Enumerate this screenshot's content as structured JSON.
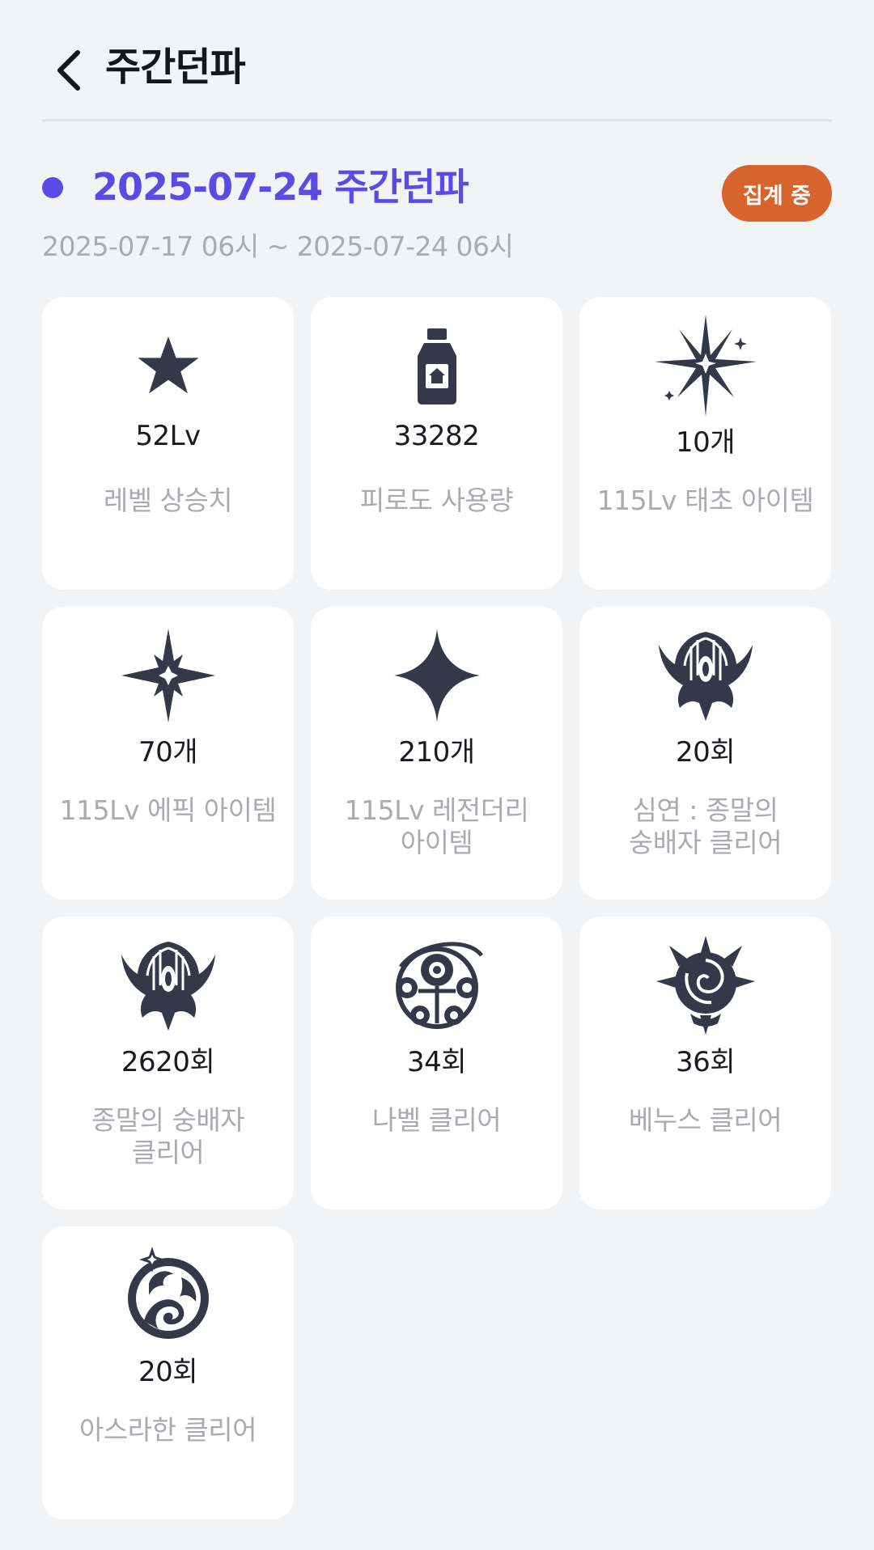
{
  "header": {
    "title": "주간던파"
  },
  "section": {
    "title": "2025-07-24 주간던파",
    "date_range": "2025-07-17 06시 ~ 2025-07-24 06시",
    "status_badge": "집계 중",
    "accent_color": "#5b4be6",
    "badge_color": "#d7642c"
  },
  "cards": [
    {
      "icon": "star-icon",
      "value": "52Lv",
      "label": "레벨 상승치"
    },
    {
      "icon": "potion-bottle-icon",
      "value": "33282",
      "label": "피로도 사용량"
    },
    {
      "icon": "burst-sparkle-icon",
      "value": "10개",
      "label": "115Lv 태초 아이템"
    },
    {
      "icon": "compass-sparkle-icon",
      "value": "70개",
      "label": "115Lv 에픽 아이템"
    },
    {
      "icon": "four-point-star-icon",
      "value": "210개",
      "label": "115Lv 레전더리\n아이템"
    },
    {
      "icon": "abyss-crest-icon",
      "value": "20회",
      "label": "심연 : 종말의\n숭배자 클리어"
    },
    {
      "icon": "cultist-crest-icon",
      "value": "2620회",
      "label": "종말의 숭배자\n클리어"
    },
    {
      "icon": "nabel-orb-icon",
      "value": "34회",
      "label": "나벨 클리어"
    },
    {
      "icon": "venus-rose-icon",
      "value": "36회",
      "label": "베누스 클리어"
    },
    {
      "icon": "asrahan-dragon-icon",
      "value": "20회",
      "label": "아스라한 클리어"
    }
  ]
}
